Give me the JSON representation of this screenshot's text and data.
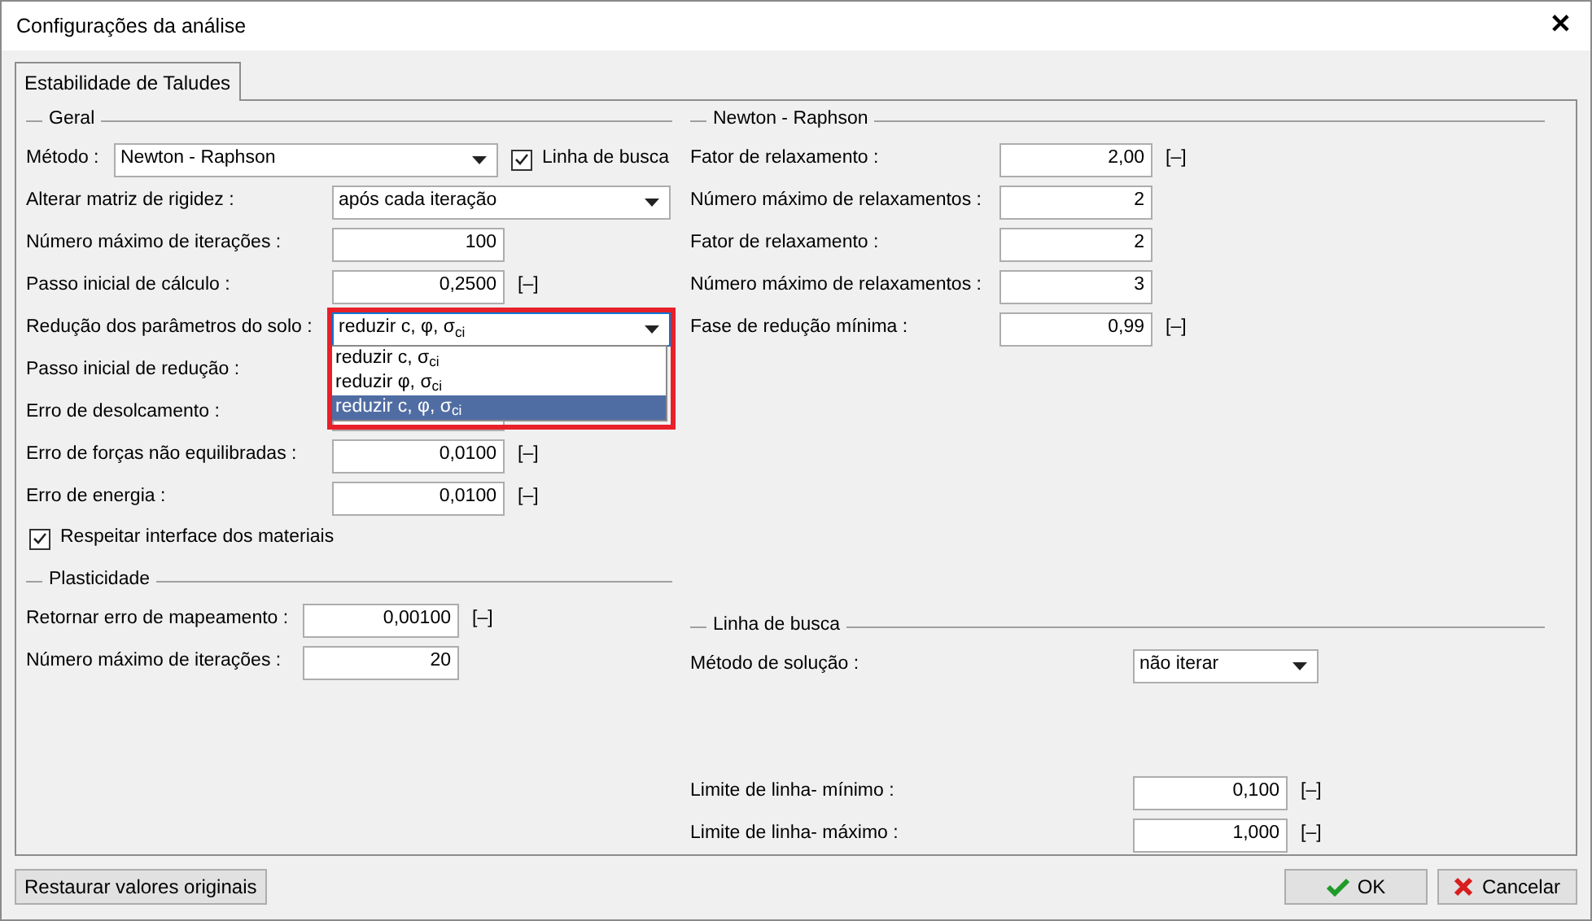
{
  "window": {
    "title": "Configurações da análise",
    "close": "✕"
  },
  "tabs": [
    {
      "label": "Estabilidade de Taludes",
      "selected": true
    }
  ],
  "left_sections": [
    {
      "title": "Geral",
      "rows": [
        {
          "kind": "method",
          "label": "Método :",
          "value": "Newton - Raphson",
          "checkbox": {
            "label": "Linha de busca",
            "checked": true
          }
        },
        {
          "kind": "select",
          "label": "Alterar matriz de rigidez :",
          "value": "após cada iteração",
          "open": false
        },
        {
          "kind": "number",
          "label": "Número máximo de iterações :",
          "value": "100"
        },
        {
          "kind": "number",
          "label": "Passo inicial de cálculo :",
          "value": "0,2500",
          "unit": "[–]"
        },
        {
          "kind": "select",
          "label": "Redução dos parâmetros do solo :",
          "value": "reduzir c, φ, σ$_{ci}$",
          "open": true,
          "options": [
            {
              "label": "reduzir c, σ$_{ci}$",
              "selected": false
            },
            {
              "label": "reduzir φ, σ$_{ci}$",
              "selected": false
            },
            {
              "label": "reduzir c, φ, σ$_{ci}$",
              "selected": true
            }
          ]
        },
        {
          "kind": "label",
          "label": "Passo inicial de redução :"
        },
        {
          "kind": "number",
          "label": "Erro de desolcamento :"
        },
        {
          "kind": "number",
          "label": "Erro de forças não equilibradas :",
          "value": "0,0100",
          "unit": "[–]"
        },
        {
          "kind": "number",
          "label": "Erro de energia :",
          "value": "0,0100",
          "unit": "[–]"
        },
        {
          "kind": "checkbox",
          "label": "Respeitar interface dos materiais",
          "checked": true
        }
      ]
    },
    {
      "title": "Plasticidade",
      "rows": [
        {
          "kind": "number",
          "label": "Retornar erro de mapeamento :",
          "value": "0,00100",
          "unit": "[–]"
        },
        {
          "kind": "number",
          "label": "Número máximo de iterações :",
          "value": "20"
        }
      ]
    }
  ],
  "right_sections": [
    {
      "title": "Newton - Raphson",
      "rows": [
        {
          "kind": "number",
          "label": "Fator de relaxamento :",
          "value": "2,00",
          "unit": "[–]"
        },
        {
          "kind": "number",
          "label": "Número máximo de relaxamentos :",
          "value": "2"
        },
        {
          "kind": "number",
          "label": "Fator de relaxamento :",
          "value": "2"
        },
        {
          "kind": "number",
          "label": "Número máximo de relaxamentos :",
          "value": "3"
        },
        {
          "kind": "number",
          "label": "Fase de redução mínima :",
          "value": "0,99",
          "unit": "[–]"
        }
      ]
    },
    {
      "title": "Linha de busca",
      "rows": [
        {
          "kind": "select",
          "label": "Método de solução :",
          "value": "não iterar",
          "open": false
        },
        {
          "kind": "gap"
        },
        {
          "kind": "number",
          "label": "Limite de linha- mínimo :",
          "value": "0,100",
          "unit": "[–]"
        },
        {
          "kind": "number",
          "label": "Limite de linha- máximo :",
          "value": "1,000",
          "unit": "[–]"
        }
      ]
    }
  ],
  "footer": {
    "restore": "Restaurar valores originais",
    "ok": "OK",
    "cancel": "Cancelar"
  }
}
